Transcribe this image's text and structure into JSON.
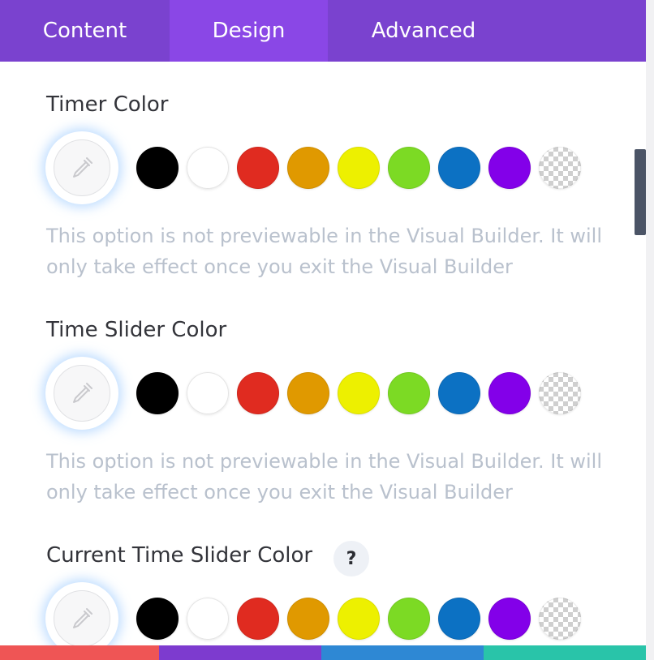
{
  "tabs": [
    {
      "label": "Content",
      "active": false
    },
    {
      "label": "Design",
      "active": true
    },
    {
      "label": "Advanced",
      "active": false
    }
  ],
  "swatches": [
    {
      "name": "black",
      "hex": "#000000"
    },
    {
      "name": "white",
      "hex": "#ffffff"
    },
    {
      "name": "red",
      "hex": "#e02b20"
    },
    {
      "name": "orange",
      "hex": "#e09900"
    },
    {
      "name": "yellow",
      "hex": "#edf000"
    },
    {
      "name": "green",
      "hex": "#7cda24"
    },
    {
      "name": "blue",
      "hex": "#0c71c3"
    },
    {
      "name": "purple",
      "hex": "#8300e9"
    },
    {
      "name": "transparent",
      "hex": "transparent"
    }
  ],
  "sections": [
    {
      "title": "Timer Color",
      "note": "This option is not previewable in the Visual Builder. It will only take effect once you exit the Visual Builder"
    },
    {
      "title": "Time Slider Color",
      "note": "This option is not previewable in the Visual Builder. It will only take effect once you exit the Visual Builder"
    },
    {
      "title": "Current Time Slider Color",
      "help": "?"
    }
  ],
  "colors": {
    "tab_bar": "#7a42cf",
    "tab_active": "#8a47e6",
    "strip": [
      "#ef5555",
      "#7d3bcf",
      "#2e88d4",
      "#29c4a9"
    ]
  },
  "icons": {
    "picker": "eyedropper-icon"
  }
}
